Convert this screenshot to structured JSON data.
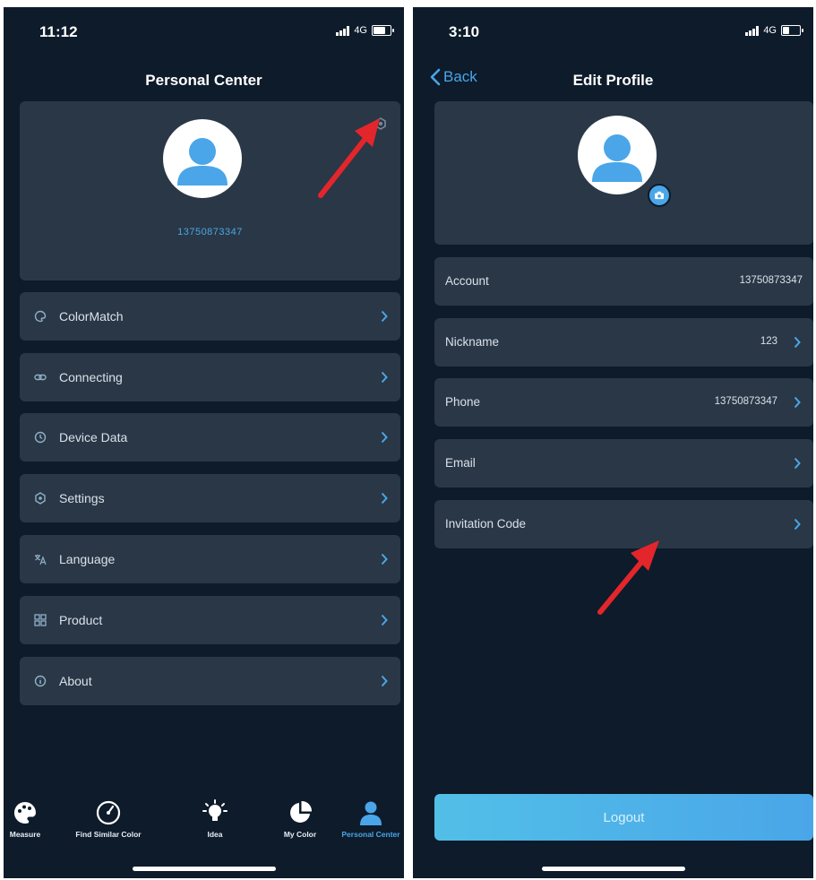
{
  "left": {
    "status": {
      "time": "11:12",
      "network": "4G"
    },
    "title": "Personal Center",
    "account_id": "13750873347",
    "menu": [
      {
        "label": "ColorMatch",
        "icon": "palette-icon"
      },
      {
        "label": "Connecting",
        "icon": "link-icon"
      },
      {
        "label": "Device Data",
        "icon": "clock-icon"
      },
      {
        "label": "Settings",
        "icon": "settings-icon"
      },
      {
        "label": "Language",
        "icon": "translate-icon"
      },
      {
        "label": "Product",
        "icon": "grid-icon"
      },
      {
        "label": "About",
        "icon": "info-icon"
      }
    ],
    "tabs": [
      {
        "label": "Measure",
        "icon": "palette-icon"
      },
      {
        "label": "Find Similar Color",
        "icon": "gauge-icon"
      },
      {
        "label": "Idea",
        "icon": "lightbulb-icon"
      },
      {
        "label": "My Color",
        "icon": "pie-chart-icon"
      },
      {
        "label": "Personal Center",
        "icon": "user-icon",
        "active": true
      }
    ]
  },
  "right": {
    "status": {
      "time": "3:10",
      "network": "4G"
    },
    "back_label": "Back",
    "title": "Edit Profile",
    "rows": [
      {
        "label": "Account",
        "value": "13750873347"
      },
      {
        "label": "Nickname",
        "value": "123"
      },
      {
        "label": "Phone",
        "value": "13750873347"
      },
      {
        "label": "Email",
        "value": ""
      },
      {
        "label": "Invitation Code",
        "value": ""
      }
    ],
    "logout_label": "Logout"
  },
  "colors": {
    "background": "#0d1b2a",
    "card": "#2a3746",
    "accent": "#4aa6e8",
    "annotation_arrow": "#e3262b"
  }
}
